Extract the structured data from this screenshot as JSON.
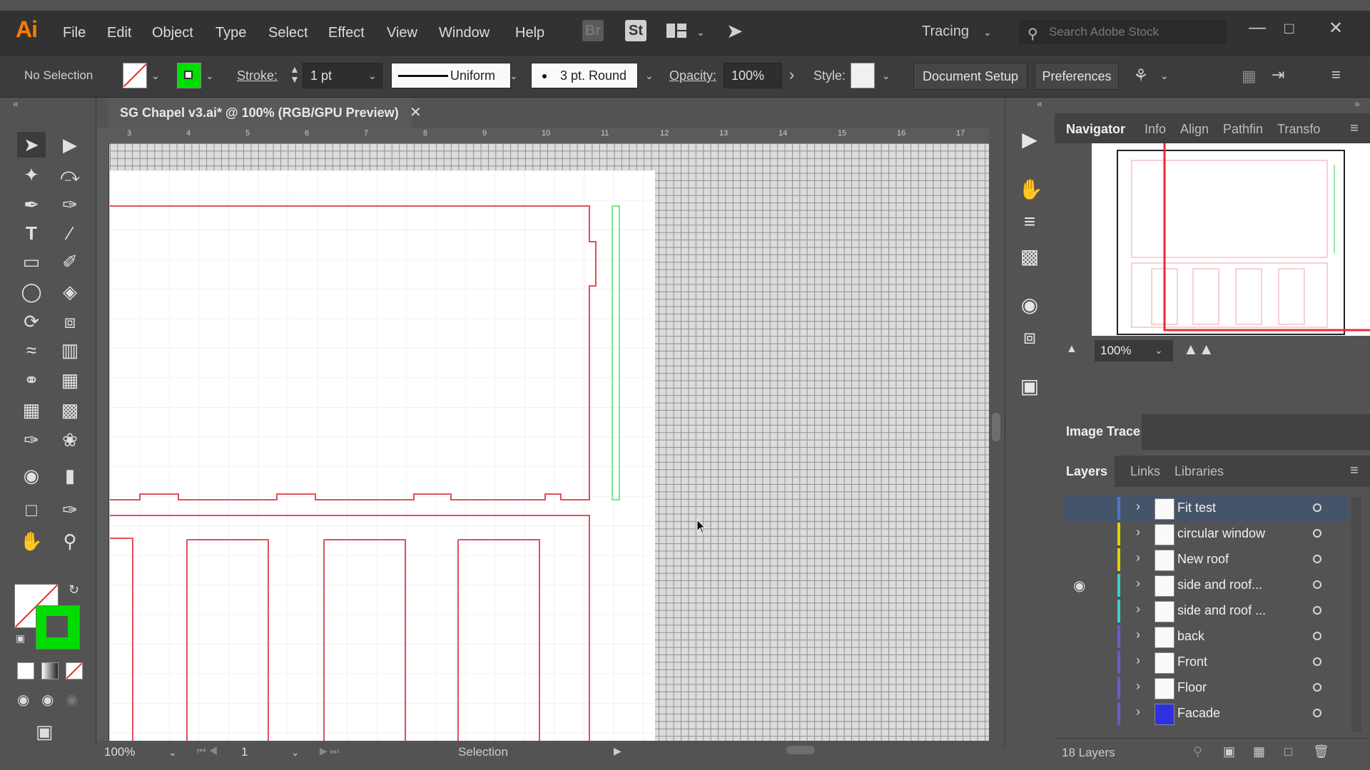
{
  "app": {
    "logo": "Ai"
  },
  "menu": [
    "File",
    "Edit",
    "Object",
    "Type",
    "Select",
    "Effect",
    "View",
    "Window",
    "Help"
  ],
  "appbar": {
    "br": "Br",
    "st": "St",
    "workspace": "Tracing",
    "search_placeholder": "Search Adobe Stock"
  },
  "control": {
    "selection": "No Selection",
    "stroke_label": "Stroke:",
    "stroke_value": "1 pt",
    "profile": "Uniform",
    "brush": "3 pt. Round",
    "opacity_label": "Opacity:",
    "opacity_value": "100%",
    "style_label": "Style:",
    "doc_setup": "Document Setup",
    "preferences": "Preferences"
  },
  "document": {
    "tab_title": "SG Chapel v3.ai* @ 100% (RGB/GPU Preview)"
  },
  "ruler": {
    "ticks": [
      "3",
      "4",
      "5",
      "6",
      "7",
      "8",
      "9",
      "10",
      "11",
      "12",
      "13",
      "14",
      "15",
      "16",
      "17"
    ]
  },
  "navigator": {
    "tabs": [
      "Navigator",
      "Info",
      "Align",
      "Pathfin",
      "Transfo"
    ],
    "zoom": "100%"
  },
  "image_trace": {
    "title": "Image Trace"
  },
  "layers_panel": {
    "tabs": [
      "Layers",
      "Links",
      "Libraries"
    ],
    "layers": [
      {
        "name": "Fit test",
        "color": "#4a78c8"
      },
      {
        "name": "circular window",
        "color": "#e2d200"
      },
      {
        "name": "New roof",
        "color": "#e2d200"
      },
      {
        "name": "side and roof...",
        "color": "#3ad1d1"
      },
      {
        "name": "side and roof ...",
        "color": "#3ad1d1"
      },
      {
        "name": "back",
        "color": "#6a5acd"
      },
      {
        "name": "Front",
        "color": "#6a5acd"
      },
      {
        "name": "Floor",
        "color": "#6a5acd"
      },
      {
        "name": "Facade",
        "color": "#6a5acd"
      }
    ],
    "count": "18 Layers"
  },
  "status": {
    "zoom": "100%",
    "artboard": "1",
    "tool": "Selection"
  },
  "colors": {
    "fill": "none",
    "stroke": "#00dd00",
    "accent": "#ff7c00",
    "artwork": "#e0505e"
  }
}
